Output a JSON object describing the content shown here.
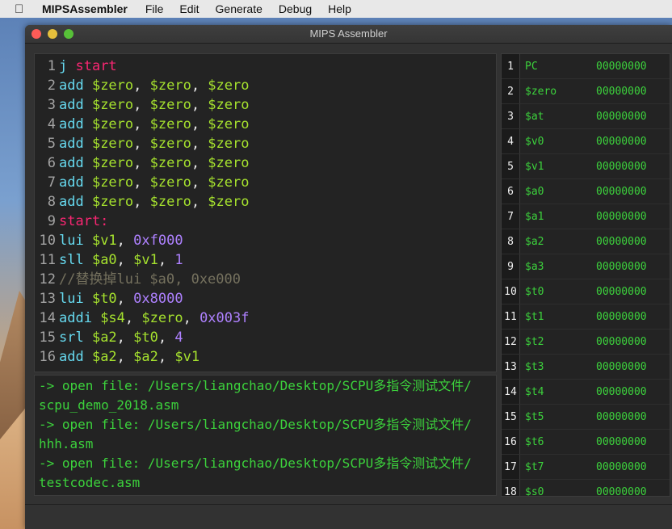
{
  "menubar": {
    "app_name": "MIPSAssembler",
    "items": [
      "File",
      "Edit",
      "Generate",
      "Debug",
      "Help"
    ]
  },
  "window": {
    "title": "MIPS Assembler"
  },
  "editor": {
    "lines": [
      {
        "n": "1",
        "tokens": [
          [
            "mnem",
            "j "
          ],
          [
            "label",
            "start"
          ]
        ]
      },
      {
        "n": "2",
        "tokens": [
          [
            "mnem",
            "add "
          ],
          [
            "reg",
            "$zero"
          ],
          [
            "plain",
            ", "
          ],
          [
            "reg",
            "$zero"
          ],
          [
            "plain",
            ", "
          ],
          [
            "reg",
            "$zero"
          ]
        ]
      },
      {
        "n": "3",
        "tokens": [
          [
            "mnem",
            "add "
          ],
          [
            "reg",
            "$zero"
          ],
          [
            "plain",
            ", "
          ],
          [
            "reg",
            "$zero"
          ],
          [
            "plain",
            ", "
          ],
          [
            "reg",
            "$zero"
          ]
        ]
      },
      {
        "n": "4",
        "tokens": [
          [
            "mnem",
            "add "
          ],
          [
            "reg",
            "$zero"
          ],
          [
            "plain",
            ", "
          ],
          [
            "reg",
            "$zero"
          ],
          [
            "plain",
            ", "
          ],
          [
            "reg",
            "$zero"
          ]
        ]
      },
      {
        "n": "5",
        "tokens": [
          [
            "mnem",
            "add "
          ],
          [
            "reg",
            "$zero"
          ],
          [
            "plain",
            ", "
          ],
          [
            "reg",
            "$zero"
          ],
          [
            "plain",
            ", "
          ],
          [
            "reg",
            "$zero"
          ]
        ]
      },
      {
        "n": "6",
        "tokens": [
          [
            "mnem",
            "add "
          ],
          [
            "reg",
            "$zero"
          ],
          [
            "plain",
            ", "
          ],
          [
            "reg",
            "$zero"
          ],
          [
            "plain",
            ", "
          ],
          [
            "reg",
            "$zero"
          ]
        ]
      },
      {
        "n": "7",
        "tokens": [
          [
            "mnem",
            "add "
          ],
          [
            "reg",
            "$zero"
          ],
          [
            "plain",
            ", "
          ],
          [
            "reg",
            "$zero"
          ],
          [
            "plain",
            ", "
          ],
          [
            "reg",
            "$zero"
          ]
        ]
      },
      {
        "n": "8",
        "tokens": [
          [
            "mnem",
            "add "
          ],
          [
            "reg",
            "$zero"
          ],
          [
            "plain",
            ", "
          ],
          [
            "reg",
            "$zero"
          ],
          [
            "plain",
            ", "
          ],
          [
            "reg",
            "$zero"
          ]
        ]
      },
      {
        "n": "9",
        "tokens": [
          [
            "label",
            "start:"
          ]
        ]
      },
      {
        "n": "10",
        "tokens": [
          [
            "mnem",
            "lui "
          ],
          [
            "reg",
            "$v1"
          ],
          [
            "plain",
            ", "
          ],
          [
            "num",
            "0xf000"
          ]
        ]
      },
      {
        "n": "11",
        "tokens": [
          [
            "mnem",
            "sll "
          ],
          [
            "reg",
            "$a0"
          ],
          [
            "plain",
            ", "
          ],
          [
            "reg",
            "$v1"
          ],
          [
            "plain",
            ", "
          ],
          [
            "num",
            "1"
          ]
        ]
      },
      {
        "n": "12",
        "tokens": [
          [
            "comment",
            "//替换掉lui $a0, 0xe000"
          ]
        ]
      },
      {
        "n": "13",
        "tokens": [
          [
            "mnem",
            "lui "
          ],
          [
            "reg",
            "$t0"
          ],
          [
            "plain",
            ", "
          ],
          [
            "num",
            "0x8000"
          ]
        ]
      },
      {
        "n": "14",
        "tokens": [
          [
            "mnem",
            "addi "
          ],
          [
            "reg",
            "$s4"
          ],
          [
            "plain",
            ", "
          ],
          [
            "reg",
            "$zero"
          ],
          [
            "plain",
            ", "
          ],
          [
            "num",
            "0x003f"
          ]
        ]
      },
      {
        "n": "15",
        "tokens": [
          [
            "mnem",
            "srl "
          ],
          [
            "reg",
            "$a2"
          ],
          [
            "plain",
            ", "
          ],
          [
            "reg",
            "$t0"
          ],
          [
            "plain",
            ", "
          ],
          [
            "num",
            "4"
          ]
        ]
      },
      {
        "n": "16",
        "tokens": [
          [
            "mnem",
            "add "
          ],
          [
            "reg",
            "$a2"
          ],
          [
            "plain",
            ", "
          ],
          [
            "reg",
            "$a2"
          ],
          [
            "plain",
            ", "
          ],
          [
            "reg",
            "$v1"
          ]
        ]
      }
    ]
  },
  "console": {
    "lines": [
      "-> open file: /Users/liangchao/Desktop/SCPU多指令测试文件/",
      "scpu_demo_2018.asm",
      "-> open file: /Users/liangchao/Desktop/SCPU多指令测试文件/",
      "hhh.asm",
      "-> open file: /Users/liangchao/Desktop/SCPU多指令测试文件/",
      "testcodec.asm"
    ]
  },
  "registers": [
    {
      "idx": "1",
      "name": "PC",
      "value": "00000000"
    },
    {
      "idx": "2",
      "name": "$zero",
      "value": "00000000"
    },
    {
      "idx": "3",
      "name": "$at",
      "value": "00000000"
    },
    {
      "idx": "4",
      "name": "$v0",
      "value": "00000000"
    },
    {
      "idx": "5",
      "name": "$v1",
      "value": "00000000"
    },
    {
      "idx": "6",
      "name": "$a0",
      "value": "00000000"
    },
    {
      "idx": "7",
      "name": "$a1",
      "value": "00000000"
    },
    {
      "idx": "8",
      "name": "$a2",
      "value": "00000000"
    },
    {
      "idx": "9",
      "name": "$a3",
      "value": "00000000"
    },
    {
      "idx": "10",
      "name": "$t0",
      "value": "00000000"
    },
    {
      "idx": "11",
      "name": "$t1",
      "value": "00000000"
    },
    {
      "idx": "12",
      "name": "$t2",
      "value": "00000000"
    },
    {
      "idx": "13",
      "name": "$t3",
      "value": "00000000"
    },
    {
      "idx": "14",
      "name": "$t4",
      "value": "00000000"
    },
    {
      "idx": "15",
      "name": "$t5",
      "value": "00000000"
    },
    {
      "idx": "16",
      "name": "$t6",
      "value": "00000000"
    },
    {
      "idx": "17",
      "name": "$t7",
      "value": "00000000"
    },
    {
      "idx": "18",
      "name": "$s0",
      "value": "00000000"
    }
  ],
  "colors": {
    "mnemonic": "#66d9ef",
    "label": "#f92672",
    "register": "#a6e22e",
    "number": "#ae81ff",
    "comment": "#75715e",
    "console_text": "#3cd23c"
  },
  "icons": {
    "apple": "apple-logo-icon"
  }
}
